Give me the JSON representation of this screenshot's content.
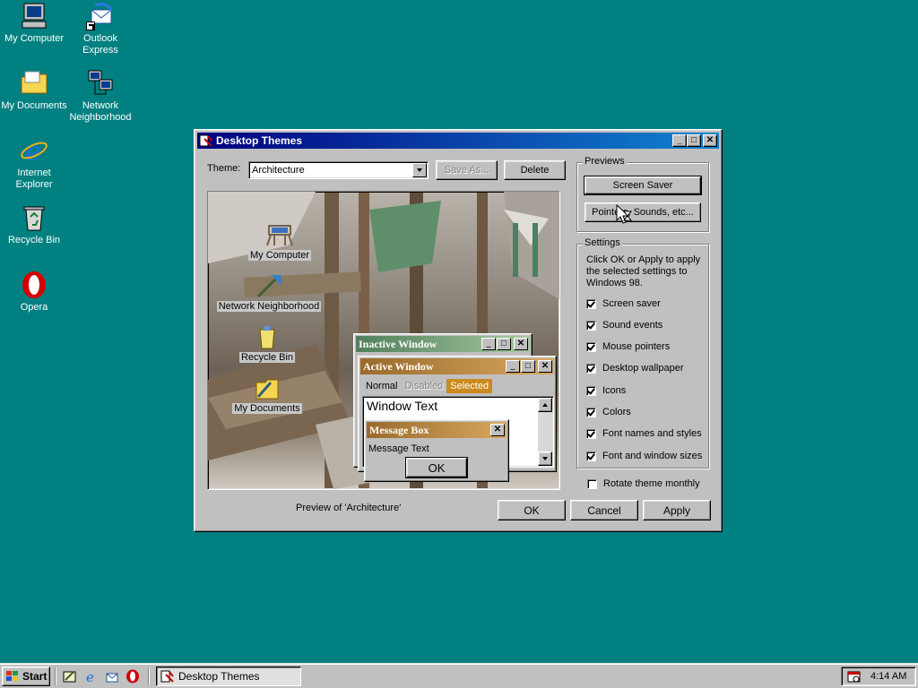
{
  "desktop": {
    "icons": [
      {
        "label_line1": "My Computer",
        "label_line2": ""
      },
      {
        "label_line1": "Outlook",
        "label_line2": "Express"
      },
      {
        "label_line1": "My Documents",
        "label_line2": ""
      },
      {
        "label_line1": "Network",
        "label_line2": "Neighborhood"
      },
      {
        "label_line1": "Internet",
        "label_line2": "Explorer"
      },
      {
        "label_line1": "Recycle Bin",
        "label_line2": ""
      },
      {
        "label_line1": "Opera",
        "label_line2": ""
      }
    ]
  },
  "dialog": {
    "title": "Desktop Themes",
    "theme_label": "Theme:",
    "theme_value": "Architecture",
    "save_as_label": "Save As...",
    "delete_label": "Delete",
    "preview_caption": "Preview of 'Architecture'",
    "previews": {
      "title": "Previews",
      "screen_saver_label": "Screen Saver",
      "pointers_label": "Pointers, Sounds, etc..."
    },
    "settings": {
      "title": "Settings",
      "description": "Click OK or Apply to apply the selected settings to Windows 98.",
      "items": [
        {
          "label": "Screen saver",
          "checked": true
        },
        {
          "label": "Sound events",
          "checked": true
        },
        {
          "label": "Mouse pointers",
          "checked": true
        },
        {
          "label": "Desktop wallpaper",
          "checked": true
        },
        {
          "label": "Icons",
          "checked": true
        },
        {
          "label": "Colors",
          "checked": true
        },
        {
          "label": "Font names and styles",
          "checked": true
        },
        {
          "label": "Font and window sizes",
          "checked": true
        }
      ]
    },
    "rotate_label": "Rotate theme monthly",
    "rotate_checked": false,
    "ok_label": "OK",
    "cancel_label": "Cancel",
    "apply_label": "Apply"
  },
  "preview": {
    "icons": [
      "My Computer",
      "Network Neighborhood",
      "Recycle Bin",
      "My Documents"
    ],
    "inactive_title": "Inactive Window",
    "active_title": "Active Window",
    "menu_normal": "Normal",
    "menu_disabled": "Disabled",
    "menu_selected": "Selected",
    "window_text": "Window Text",
    "msgbox_title": "Message Box",
    "msgbox_text": "Message Text",
    "msgbox_ok": "OK"
  },
  "taskbar": {
    "start_label": "Start",
    "task_label": "Desktop Themes",
    "clock": "4:14 AM"
  },
  "colors": {
    "desktop_bg": "#008080",
    "title_active": "#000080",
    "theme_inactive_title": "#4f7f5a",
    "theme_active_title": "#9a6a2c",
    "selected_menu": "#c98a1f"
  }
}
